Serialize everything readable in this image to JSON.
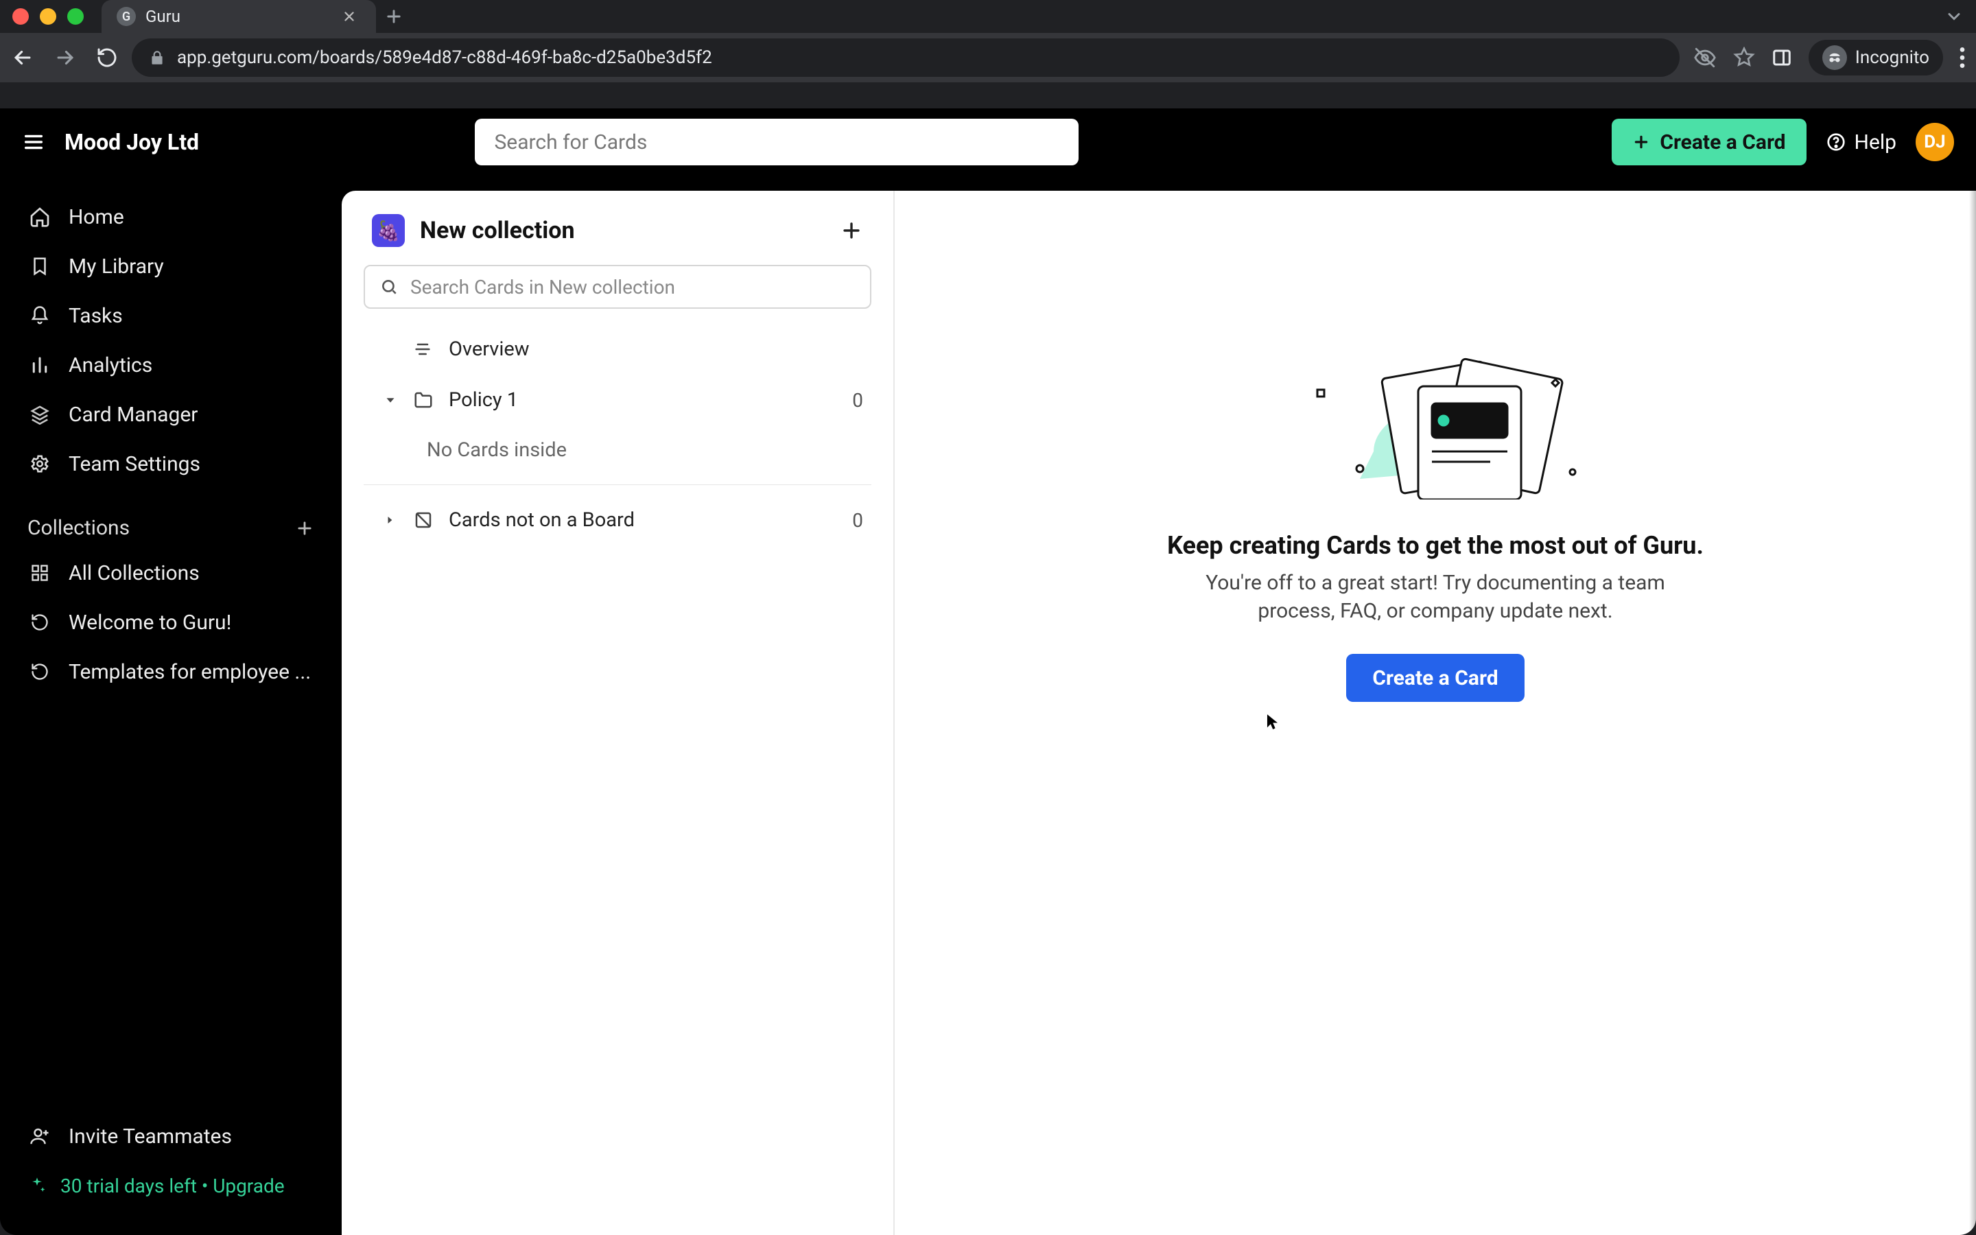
{
  "browser": {
    "tab_title": "Guru",
    "url": "app.getguru.com/boards/589e4d87-c88d-469f-ba8c-d25a0be3d5f2",
    "incognito_label": "Incognito"
  },
  "header": {
    "org_name": "Mood Joy Ltd",
    "search_placeholder": "Search for Cards",
    "create_card_label": "Create a Card",
    "help_label": "Help",
    "avatar_initials": "DJ"
  },
  "sidebar": {
    "items": [
      {
        "label": "Home",
        "icon": "home-icon"
      },
      {
        "label": "My Library",
        "icon": "bookmark-icon"
      },
      {
        "label": "Tasks",
        "icon": "bell-icon"
      },
      {
        "label": "Analytics",
        "icon": "bars-icon"
      },
      {
        "label": "Card Manager",
        "icon": "layers-icon"
      },
      {
        "label": "Team Settings",
        "icon": "gear-icon"
      }
    ],
    "collections_label": "Collections",
    "collections": [
      {
        "label": "All Collections",
        "icon": "grid-icon"
      },
      {
        "label": "Welcome to Guru!",
        "icon": "refresh-icon"
      },
      {
        "label": "Templates for employee ...",
        "icon": "refresh-icon"
      }
    ],
    "invite_label": "Invite Teammates",
    "trial_label": "30 trial days left • Upgrade"
  },
  "collection_panel": {
    "title": "New collection",
    "badge_emoji": "🍇",
    "search_placeholder": "Search Cards in New collection",
    "overview_label": "Overview",
    "folders": [
      {
        "label": "Policy 1",
        "count": "0",
        "expanded": true,
        "empty_label": "No Cards inside"
      }
    ],
    "loose": {
      "label": "Cards not on a Board",
      "count": "0"
    }
  },
  "empty_state": {
    "title": "Keep creating Cards to get the most out of Guru.",
    "subtitle": "You're off to a great start! Try documenting a team process, FAQ, or company update next.",
    "button_label": "Create a Card"
  },
  "colors": {
    "accent_green": "#4be0a7",
    "primary_blue": "#2563eb",
    "trial_green": "#36d399",
    "avatar_orange": "#f59e0b"
  }
}
